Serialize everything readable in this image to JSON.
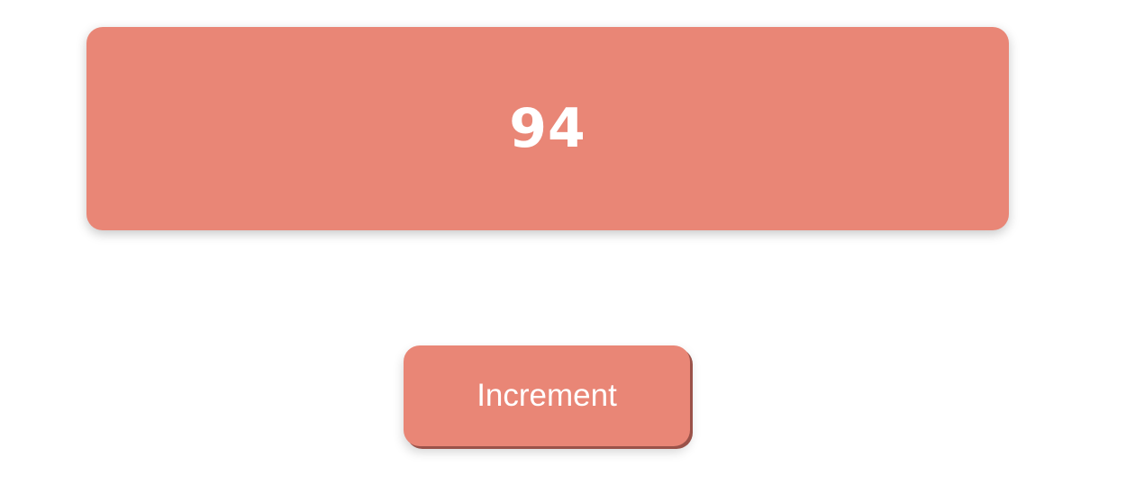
{
  "counter": {
    "value": "94"
  },
  "controls": {
    "increment_label": "Increment"
  },
  "colors": {
    "accent": "#e98676",
    "button_shadow": "#9a5249",
    "text": "#ffffff",
    "background": "#ffffff"
  }
}
